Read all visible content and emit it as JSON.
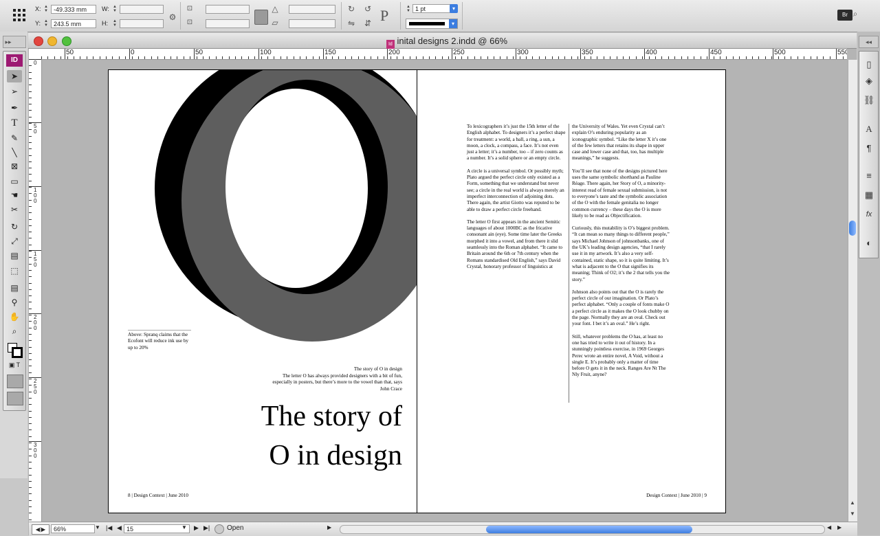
{
  "control_panel": {
    "x_label": "X:",
    "x_value": "-49.333 mm",
    "y_label": "Y:",
    "y_value": "243.5 mm",
    "w_label": "W:",
    "h_label": "H:",
    "stroke_weight": "1 pt",
    "icons": [
      "reference-point-icon",
      "scale-x-icon",
      "scale-y-icon",
      "constrain-proportions-icon",
      "rotate-icon",
      "shear-icon",
      "rotate-cw-icon",
      "rotate-ccw-icon",
      "flip-horizontal-icon",
      "flip-vertical-icon",
      "paragraph-p-icon",
      "bridge-icon"
    ]
  },
  "window": {
    "title": "inital designs 2.indd @ 66%"
  },
  "rulers": {
    "h_numbers": [
      "50",
      "0",
      "50",
      "100",
      "150",
      "200",
      "250",
      "300",
      "350",
      "400",
      "450",
      "500",
      "550"
    ],
    "v_numbers": [
      "0",
      "50",
      "100",
      "150",
      "200",
      "250",
      "300"
    ]
  },
  "left_page": {
    "caption": "Above: Spranq claims that the Ecofont will reduce ink use by up to 20%",
    "standfirst_title": "The story of O in design",
    "standfirst_body": "The letter O has always provided designers with a bit of fun, especially in posters, but there’s more to the vowel than that, says John Crace",
    "headline_line1": "The story of",
    "headline_line2": "O in design",
    "folio": "8 | Design Context | June 2010"
  },
  "right_page": {
    "column1": [
      "To lexicographers it’s just the 15th letter of the English alphabet. To designers it’s a perfect shape for treatment: a world, a ball, a ring, a sun, a moon, a clock, a compass, a face. It’s not even just a letter; it’s a number, too – if zero counts as a number. It’s a solid sphere or an empty circle.",
      "A circle is a universal symbol. Or possibly myth; Plato argued the perfect circle only existed as a Form, something that we understand but never see; a circle in the real world is always merely an imperfect interconnection of adjoining dots. There again, the artist Giotto was reputed to be able to draw a perfect circle freehand.",
      "The letter O first appears in the ancient Semitic languages of about 1000BC as the fricative consonant ain (eye). Some time later the Greeks morphed it into a vowel, and from there it slid seamlessly into the Roman alphabet. “It came to Britain around the 6th or 7th century when the Romans standardised Old English,” says David Crystal, honorary professor of linguistics at"
    ],
    "column2": [
      "the University of Wales. Yet even Crystal can’t explain O’s enduring popularity as an iconographic symbol. “Like the letter X it’s one of the few letters that retains its shape in upper case and lower case and that, too, has multiple meanings,” he suggests.",
      "You’ll see that none of the designs pictured here uses the same symbolic shorthand as Pauline Réage. There again, her Story of O, a minority-interest read of female sexual submission, is not to everyone’s taste and the symbolic association of the O with the female genitalia no longer common currency – these days the O is more likely to be read as Objectification.",
      "Curiously, this mutability is O’s biggest problem. “It can mean so many things to different people,” says Michael Johnson of johnsonbanks, one of the UK’s leading design agencies, “that I rarely use it in my artwork. It’s also a very self-contained, static shape, so it is quite limiting. It’s what is adjacent to the O that signifies its meaning; Think of O2; it’s the 2 that tells you the story.”",
      "Johnson also points out that the O is rarely the perfect circle of our imagination. Or Plato’s perfect alphabet. “Only a couple of fonts make O a perfect circle as it makes the O look chubby on the page. Normally they are an oval. Check out your font. I bet it’s an oval.” He’s right.",
      "Still, whatever problems the O has, at least no one has tried to write it out of history. In a stunningly pointless exercise, in 1969 Georges Perec wrote an entire novel, A Void, without a single E. It’s probably only a matter of time before O gets it in the neck. Ranges Are Nt The Nly Fruit, anyne?"
    ],
    "folio": "Design Context | June 2010 | 9"
  },
  "status_bar": {
    "zoom": "66%",
    "page": "15",
    "preflight": "Open"
  },
  "colors": {
    "dark_o": "#000000",
    "grey_o": "#5e5e5e",
    "pasteboard": "#b4b4b4"
  }
}
